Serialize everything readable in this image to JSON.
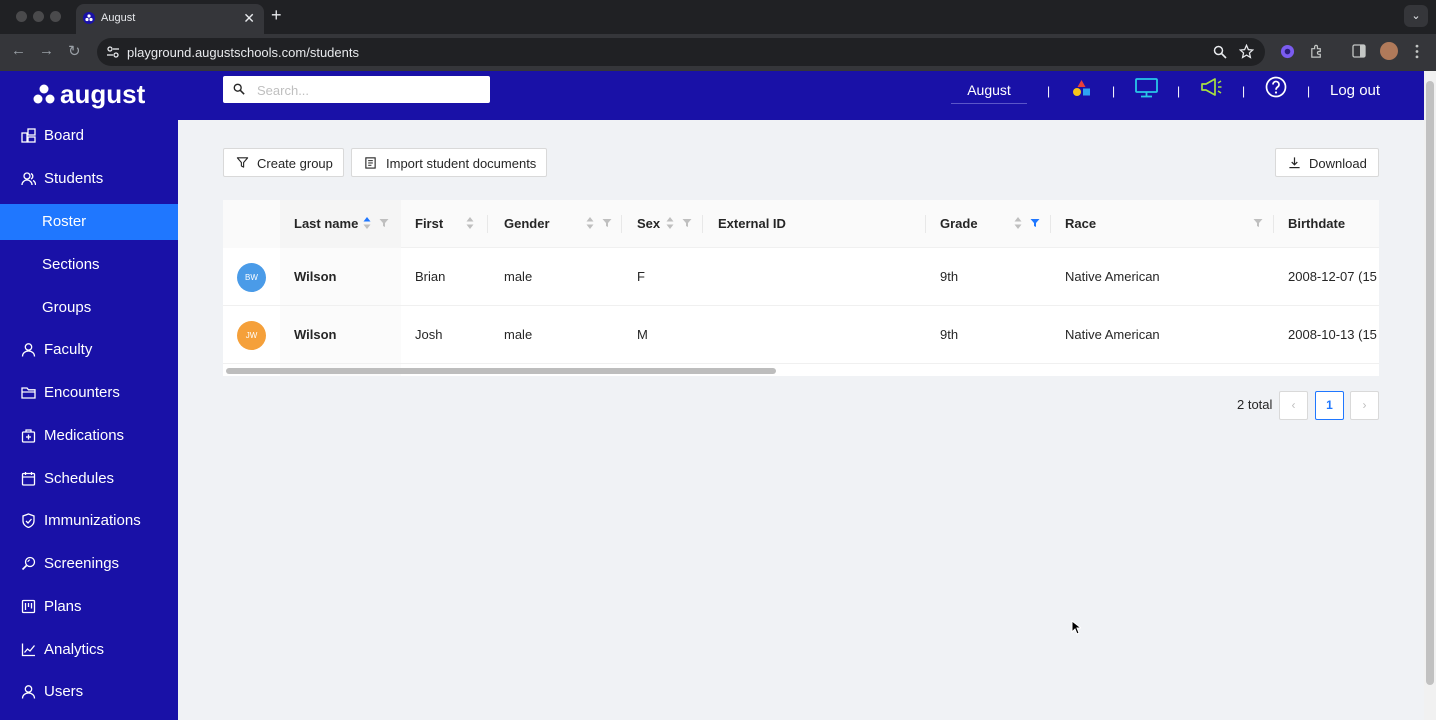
{
  "browser": {
    "tab_title": "August",
    "tab_close": "✕",
    "new_tab": "+",
    "tab_menu": "⌄",
    "url": "playground.augustschools.com/students",
    "back": "←",
    "forward": "→",
    "reload": "↻"
  },
  "app": {
    "logo_text": "august",
    "search_placeholder": "Search...",
    "user": "August",
    "logout": "Log out",
    "separator": "|"
  },
  "sidebar": {
    "items": [
      {
        "label": "Board",
        "icon": "board-icon"
      },
      {
        "label": "Students",
        "icon": "students-icon"
      },
      {
        "label": "Roster",
        "sub": true,
        "active": true
      },
      {
        "label": "Sections",
        "sub": true
      },
      {
        "label": "Groups",
        "sub": true
      },
      {
        "label": "Faculty",
        "icon": "faculty-icon"
      },
      {
        "label": "Encounters",
        "icon": "folder-icon"
      },
      {
        "label": "Medications",
        "icon": "medkit-icon"
      },
      {
        "label": "Schedules",
        "icon": "calendar-icon"
      },
      {
        "label": "Immunizations",
        "icon": "shield-icon"
      },
      {
        "label": "Screenings",
        "icon": "screening-icon"
      },
      {
        "label": "Plans",
        "icon": "plans-icon"
      },
      {
        "label": "Analytics",
        "icon": "chart-icon"
      },
      {
        "label": "Users",
        "icon": "users-icon"
      }
    ]
  },
  "toolbar": {
    "create_group": "Create group",
    "import_docs": "Import student documents",
    "download": "Download"
  },
  "table": {
    "columns": [
      "Last name",
      "First",
      "Gender",
      "Sex",
      "External ID",
      "Grade",
      "Race",
      "Birthdate"
    ],
    "rows": [
      {
        "initials": "BW",
        "avatar_color": "#4a9be8",
        "last": "Wilson",
        "first": "Brian",
        "gender": "male",
        "sex": "F",
        "external_id": "",
        "grade": "9th",
        "race": "Native American",
        "birthdate": "2008-12-07 (15 y"
      },
      {
        "initials": "JW",
        "avatar_color": "#f5a03a",
        "last": "Wilson",
        "first": "Josh",
        "gender": "male",
        "sex": "M",
        "external_id": "",
        "grade": "9th",
        "race": "Native American",
        "birthdate": "2008-10-13 (15 y"
      }
    ]
  },
  "pagination": {
    "total": "2 total",
    "page": "1",
    "prev": "‹",
    "next": "›"
  },
  "colors": {
    "brand": "#1911a7",
    "accent": "#1f77ff"
  }
}
